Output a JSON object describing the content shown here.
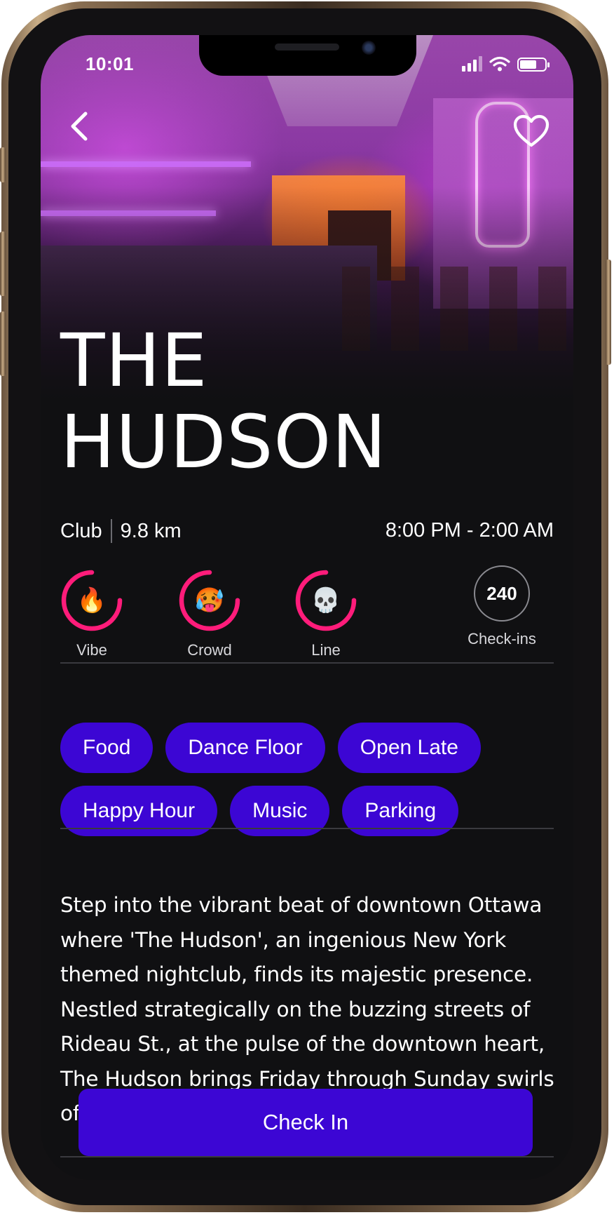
{
  "status_bar": {
    "time": "10:01"
  },
  "venue": {
    "title_line1": "THE",
    "title_line2": "HUDSON",
    "type": "Club",
    "distance": "9.8 km",
    "hours": "8:00 PM - 2:00 AM"
  },
  "ratings": [
    {
      "label": "Vibe",
      "emoji": "🔥",
      "level": 0.75
    },
    {
      "label": "Crowd",
      "emoji": "🥵",
      "level": 0.75
    },
    {
      "label": "Line",
      "emoji": "💀",
      "level": 0.75
    }
  ],
  "checkins": {
    "count": "240",
    "label": "Check-ins"
  },
  "tags": {
    "row1": [
      "Food",
      "Dance Floor",
      "Open Late"
    ],
    "row2": [
      "Happy Hour",
      "Music",
      "Parking"
    ]
  },
  "description": "Step into the vibrant beat of downtown Ottawa where 'The Hudson', an ingenious New York themed nightclub, finds its majestic presence. Nestled strategically on the buzzing streets of Rideau St., at the pulse of the downtown heart, The Hudson brings Friday through Sunday swirls of opulence leavened with hospitable pl",
  "actions": {
    "checkin_label": "Check In"
  },
  "icons": {
    "back": "back-chevron-icon",
    "favorite": "heart-icon"
  },
  "colors": {
    "accent": "#3c06d4",
    "ring": "#ff1c7a",
    "background": "#101012"
  }
}
